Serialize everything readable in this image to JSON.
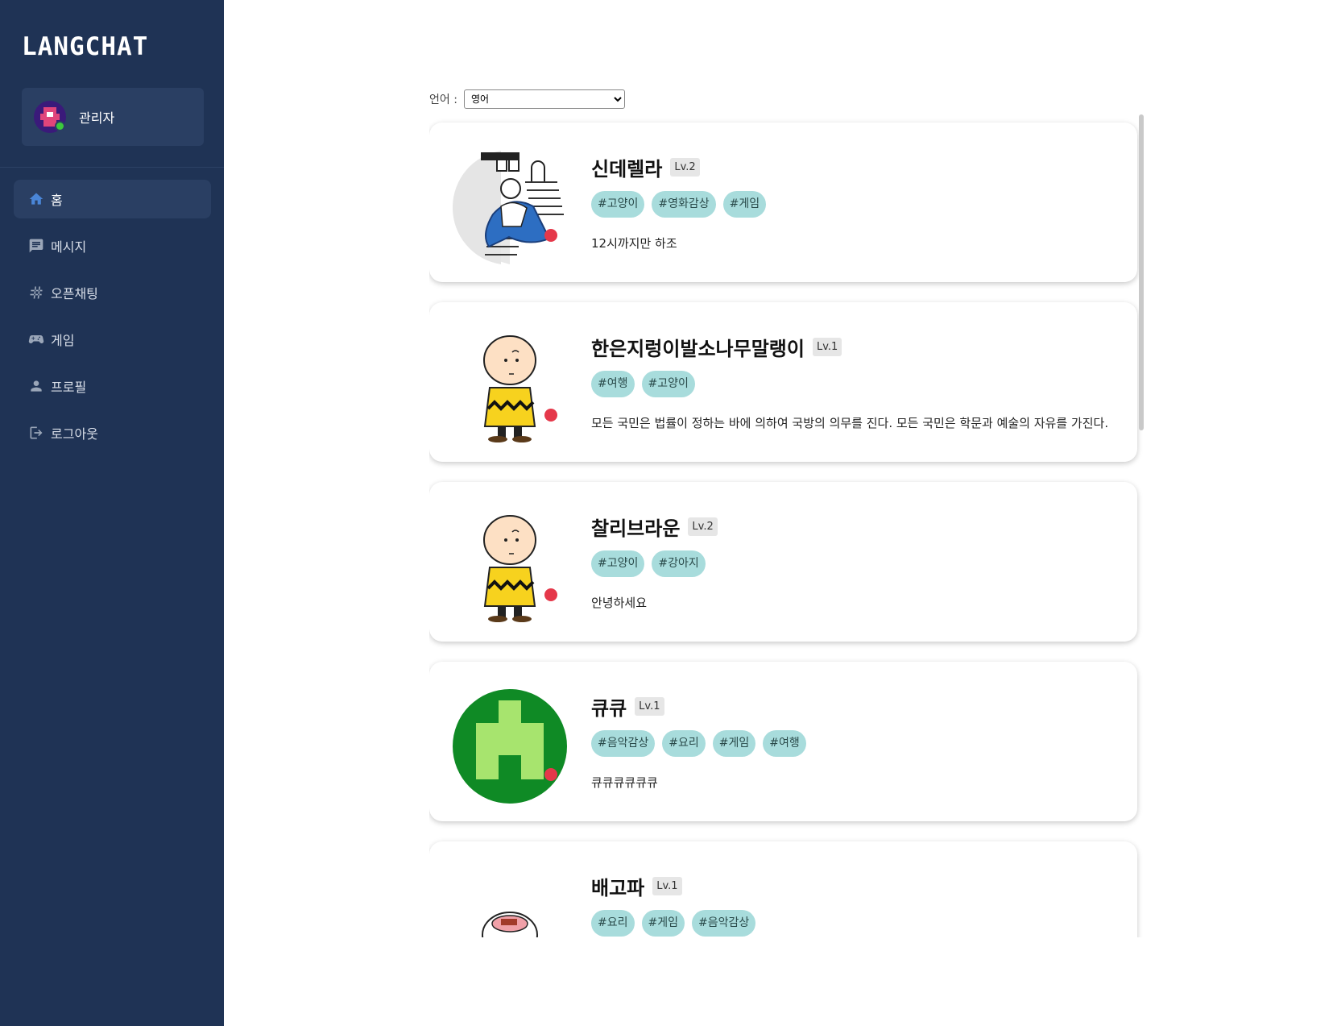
{
  "app": {
    "logo": "LANGCHAT"
  },
  "user": {
    "name": "관리자"
  },
  "nav": {
    "items": [
      {
        "label": "홈",
        "icon": "home-icon",
        "active": true
      },
      {
        "label": "메시지",
        "icon": "message-icon"
      },
      {
        "label": "오픈채팅",
        "icon": "hash-icon"
      },
      {
        "label": "게임",
        "icon": "gamepad-icon"
      },
      {
        "label": "프로필",
        "icon": "person-icon"
      },
      {
        "label": "로그아웃",
        "icon": "logout-icon"
      }
    ]
  },
  "language": {
    "label": "언어 :",
    "selected": "영어"
  },
  "status_color": "#e5384a",
  "cards": [
    {
      "name": "신데렐라",
      "level": "Lv.2",
      "tags": [
        "#고양이",
        "#영화감상",
        "#게임"
      ],
      "message": "12시까지만 하조"
    },
    {
      "name": "한은지렁이발소나무말랭이",
      "level": "Lv.1",
      "tags": [
        "#여행",
        "#고양이"
      ],
      "message": "모든 국민은 법률이 정하는 바에 의하여 국방의 의무를 진다. 모든 국민은 학문과 예술의 자유를 가진다."
    },
    {
      "name": "찰리브라운",
      "level": "Lv.2",
      "tags": [
        "#고양이",
        "#강아지"
      ],
      "message": "안녕하세요"
    },
    {
      "name": "큐큐",
      "level": "Lv.1",
      "tags": [
        "#음악감상",
        "#요리",
        "#게임",
        "#여행"
      ],
      "message": "큐큐큐큐큐큐"
    },
    {
      "name": "배고파",
      "level": "Lv.1",
      "tags": [
        "#요리",
        "#게임",
        "#음악감상"
      ],
      "message": ""
    }
  ]
}
